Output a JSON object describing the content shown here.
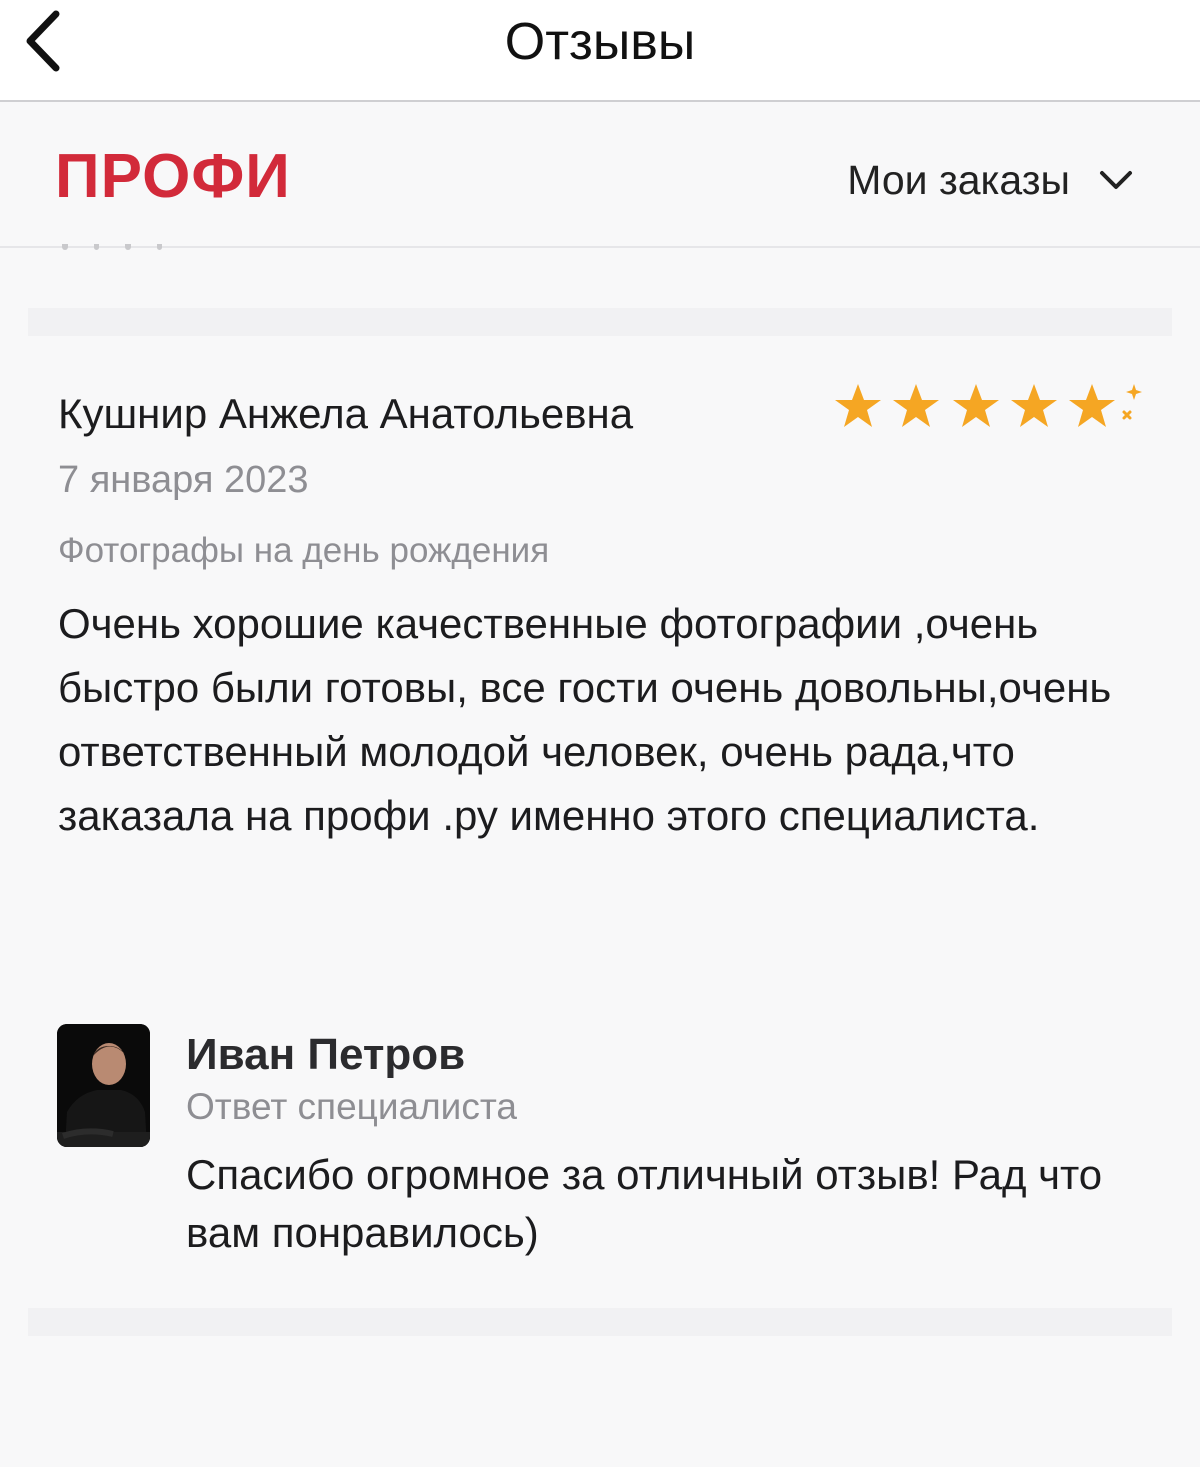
{
  "nav": {
    "title": "Отзывы",
    "back_icon": "chevron-left-icon"
  },
  "header": {
    "logo_text": "ПРОФИ",
    "logo_color": "#d22a3a",
    "orders_label": "Мои заказы",
    "orders_icon": "chevron-down-icon"
  },
  "review": {
    "author": "Кушнир Анжела Анатольевна",
    "date": "7 января 2023",
    "service": "Фотографы на день рождения",
    "text": "Очень хорошие качественные фотографии ,очень быстро были готовы, все гости очень довольны,очень ответственный молодой человек, очень рада,что заказала на профи .ру именно этого специалиста.",
    "rating": 5,
    "star_color": "#f5a623"
  },
  "reply": {
    "name": "Иван Петров",
    "role": "Ответ специалиста",
    "text": "Спасибо огромное за отличный отзыв! Рад что вам понравилось)"
  }
}
